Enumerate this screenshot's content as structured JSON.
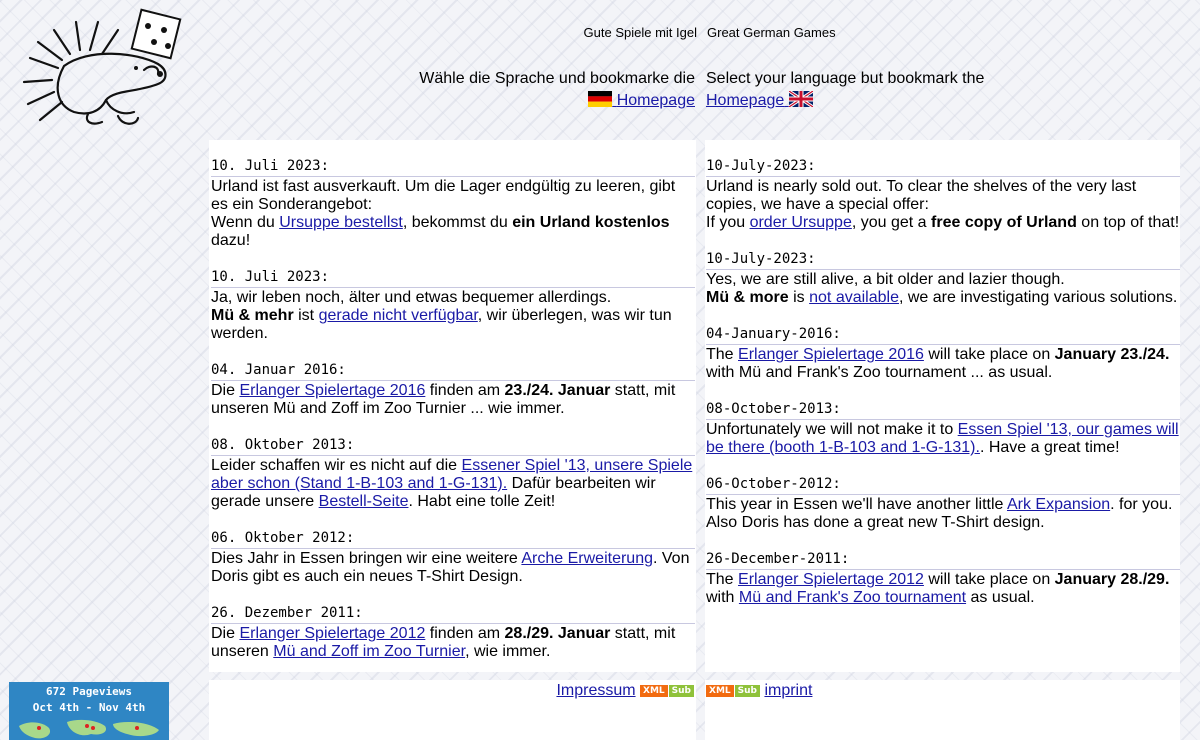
{
  "header": {
    "tagline_de": "Gute Spiele mit Igel",
    "tagline_en": "Great German Games",
    "lang_de_text": "Wähle die Sprache und bookmarke die",
    "lang_de_link": "Homepage",
    "lang_en_text": "Select your language but bookmark the",
    "lang_en_link": "Homepage"
  },
  "news_de": [
    {
      "date": "10. Juli 2023:",
      "parts": [
        {
          "t": "Urland ist fast ausverkauft. Um die Lager endgültig zu leeren, gibt es ein Sonderangebot:"
        },
        {
          "br": true
        },
        {
          "t": "Wenn du "
        },
        {
          "a": "Ursuppe bestellst"
        },
        {
          "t": ", bekommst du "
        },
        {
          "b": "ein Urland kostenlos"
        },
        {
          "t": " dazu!"
        }
      ]
    },
    {
      "date": "10. Juli 2023:",
      "parts": [
        {
          "t": "Ja, wir leben noch, älter und etwas bequemer allerdings."
        },
        {
          "br": true
        },
        {
          "b": "Mü & mehr"
        },
        {
          "t": " ist "
        },
        {
          "a": "gerade nicht verfügbar"
        },
        {
          "t": ", wir überlegen, was wir tun werden."
        }
      ]
    },
    {
      "date": "04. Januar 2016:",
      "parts": [
        {
          "t": "Die "
        },
        {
          "a": "Erlanger Spielertage 2016"
        },
        {
          "t": " finden am "
        },
        {
          "b": "23./24. Januar"
        },
        {
          "t": " statt, mit unseren Mü and Zoff im Zoo Turnier ... wie immer."
        }
      ]
    },
    {
      "date": "08. Oktober 2013:",
      "parts": [
        {
          "t": "Leider schaffen wir es nicht auf die "
        },
        {
          "a": "Essener Spiel '13, unsere Spiele aber schon (Stand 1-B-103 and 1-G-131)."
        },
        {
          "t": " Dafür bearbeiten wir gerade unsere "
        },
        {
          "a": "Bestell-Seite"
        },
        {
          "t": ". Habt eine tolle Zeit!"
        }
      ]
    },
    {
      "date": "06. Oktober 2012:",
      "parts": [
        {
          "t": "Dies Jahr in Essen bringen wir eine weitere "
        },
        {
          "a": "Arche Erweiterung"
        },
        {
          "t": ". Von Doris gibt es auch ein neues T-Shirt Design."
        }
      ]
    },
    {
      "date": "26. Dezember 2011:",
      "parts": [
        {
          "t": "Die "
        },
        {
          "a": "Erlanger Spielertage 2012"
        },
        {
          "t": " finden am "
        },
        {
          "b": "28./29. Januar"
        },
        {
          "t": " statt, mit unseren "
        },
        {
          "a": "Mü and Zoff im Zoo Turnier"
        },
        {
          "t": ", wie immer."
        }
      ]
    }
  ],
  "news_en": [
    {
      "date": "10-July-2023:",
      "parts": [
        {
          "t": "Urland is nearly sold out. To clear the shelves of the very last copies, we have a special offer:"
        },
        {
          "br": true
        },
        {
          "t": "If you "
        },
        {
          "a": "order Ursuppe"
        },
        {
          "t": ", you get a "
        },
        {
          "b": "free copy of Urland"
        },
        {
          "t": " on top of that!"
        }
      ]
    },
    {
      "date": "10-July-2023:",
      "parts": [
        {
          "t": "Yes, we are still alive, a bit older and lazier though."
        },
        {
          "br": true
        },
        {
          "b": "Mü & more"
        },
        {
          "t": " is "
        },
        {
          "a": "not available"
        },
        {
          "t": ", we are investigating various solutions."
        }
      ]
    },
    {
      "date": "04-January-2016:",
      "parts": [
        {
          "t": "The "
        },
        {
          "a": "Erlanger Spielertage 2016"
        },
        {
          "t": " will take place on "
        },
        {
          "b": "January 23./24."
        },
        {
          "t": " with Mü and Frank's Zoo tournament ... as usual."
        }
      ]
    },
    {
      "date": "08-October-2013:",
      "parts": [
        {
          "t": "Unfortunately we will not make it to "
        },
        {
          "a": "Essen Spiel '13, our games will be there (booth 1-B-103 and 1-G-131)."
        },
        {
          "t": ". Have a great time!"
        }
      ]
    },
    {
      "date": "06-October-2012:",
      "parts": [
        {
          "t": "This year in Essen we'll have another little "
        },
        {
          "a": "Ark Expansion"
        },
        {
          "t": ". for you. Also Doris has done a great new T-Shirt design."
        }
      ]
    },
    {
      "date": "26-December-2011:",
      "parts": [
        {
          "t": "The "
        },
        {
          "a": "Erlanger Spielertage 2012"
        },
        {
          "t": " will take place on "
        },
        {
          "b": "January 28./29."
        },
        {
          "t": " with "
        },
        {
          "a": "Mü and Frank's Zoo tournament"
        },
        {
          "t": " as usual."
        }
      ]
    }
  ],
  "footer": {
    "impressum": "Impressum",
    "imprint": "imprint",
    "xml_badge": "XML",
    "sub_badge": "Sub"
  },
  "counter": {
    "pageviews": "672 Pageviews",
    "range": "Oct 4th - Nov 4th"
  },
  "icons": {
    "logo": "hedgehog-with-die-logo",
    "flag_de": "flag-germany-icon",
    "flag_en": "flag-uk-icon"
  }
}
